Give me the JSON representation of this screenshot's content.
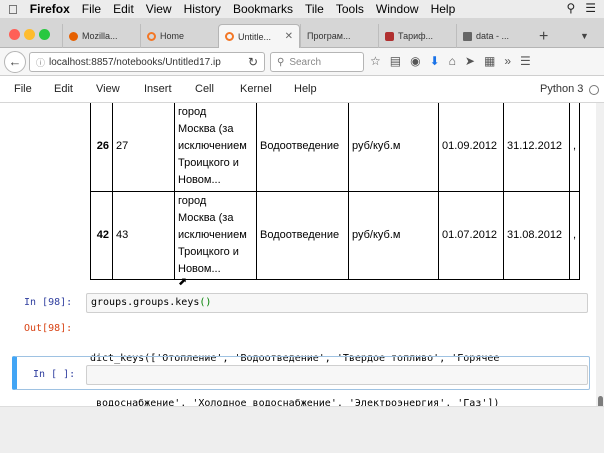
{
  "mac_menu": {
    "app": "Firefox",
    "items": [
      "File",
      "Edit",
      "View",
      "History",
      "Bookmarks",
      "Tile",
      "Tools",
      "Window",
      "Help"
    ]
  },
  "tabs": [
    {
      "label": "Mozilla...",
      "icon": "firefox-icon",
      "color": "#e66000"
    },
    {
      "label": "Home",
      "icon": "jupyter-icon",
      "color": "#f37726"
    },
    {
      "label": "Untitle...",
      "icon": "jupyter-icon",
      "color": "#f37726",
      "active": true
    },
    {
      "label": "Програм...",
      "icon": "page-icon",
      "color": "#999999"
    },
    {
      "label": "Тариф...",
      "icon": "tag-icon",
      "color": "#b03030"
    },
    {
      "label": "data - ...",
      "icon": "folder-icon",
      "color": "#666666"
    }
  ],
  "navbar": {
    "url": "localhost:8857/notebooks/Untitled17.ip",
    "search_placeholder": "Search"
  },
  "jupyter_menu": {
    "items": [
      "File",
      "Edit",
      "View",
      "Insert",
      "Cell",
      "Kernel",
      "Help"
    ],
    "kernel": "Python 3"
  },
  "table": {
    "rows": [
      {
        "idx": "26",
        "c1": "27",
        "region": [
          "город",
          "Москва (за",
          "исключением",
          "Троицкого и",
          "Новом..."
        ],
        "service": "Водоотведение",
        "unit": "руб/куб.м",
        "start": "01.09.2012",
        "end": "31.12.2012",
        "more": ","
      },
      {
        "idx": "42",
        "c1": "43",
        "region": [
          "город",
          "Москва (за",
          "исключением",
          "Троицкого и",
          "Новом..."
        ],
        "service": "Водоотведение",
        "unit": "руб/куб.м",
        "start": "01.07.2012",
        "end": "31.08.2012",
        "more": ","
      }
    ]
  },
  "cells": {
    "in_prompt": "In [98]:",
    "code": "groups.groups.keys",
    "code_parens": "()",
    "out_prompt": "Out[98]:",
    "output_line1": "dict_keys(['Отопление', 'Водоотведение', 'Твердое топливо', 'Горячее",
    "output_line2": " водоснабжение', 'Холодное водоснабжение', 'Электроэнергия', 'Газ'])",
    "new_prompt": "In [ ]:"
  },
  "colors": {
    "in_prompt": "#303f9f",
    "out_prompt": "#d84315",
    "selected_cell": "#42a5f5"
  }
}
